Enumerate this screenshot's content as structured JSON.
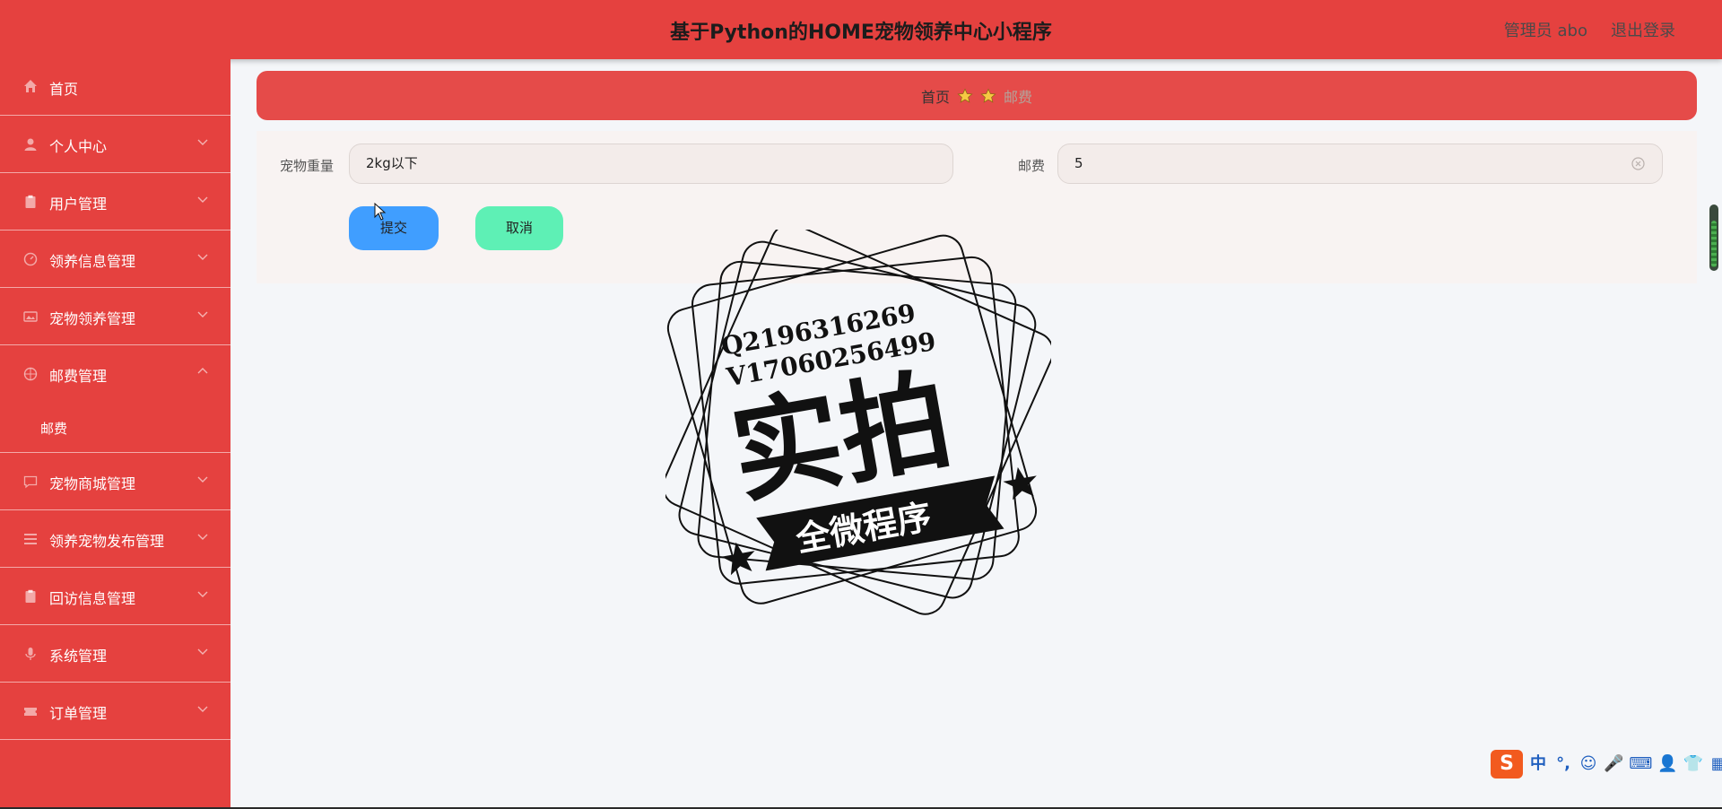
{
  "header": {
    "title": "基于Python的HOME宠物领养中心小程序",
    "user": "管理员 abo",
    "logout": "退出登录"
  },
  "sidebar": {
    "items": [
      {
        "label": "首页",
        "icon": "home-icon"
      },
      {
        "label": "个人中心",
        "icon": "user-icon"
      },
      {
        "label": "用户管理",
        "icon": "clipboard-icon"
      },
      {
        "label": "领养信息管理",
        "icon": "dashboard-icon"
      },
      {
        "label": "宠物领养管理",
        "icon": "picture-icon"
      },
      {
        "label": "邮费管理",
        "icon": "basketball-icon",
        "expanded": true,
        "sub": [
          {
            "label": "邮费"
          }
        ]
      },
      {
        "label": "宠物商城管理",
        "icon": "chat-icon"
      },
      {
        "label": "领养宠物发布管理",
        "icon": "list-icon"
      },
      {
        "label": "回访信息管理",
        "icon": "document-icon"
      },
      {
        "label": "系统管理",
        "icon": "microphone-icon"
      },
      {
        "label": "订单管理",
        "icon": "ticket-icon"
      }
    ]
  },
  "breadcrumb": {
    "home": "首页",
    "current": "邮费",
    "separator_icon": "star-icon"
  },
  "form": {
    "weight_label": "宠物重量",
    "weight_value": "2kg以下",
    "fee_label": "邮费",
    "fee_value": "5",
    "submit_label": "提交",
    "cancel_label": "取消"
  },
  "watermark": {
    "qq": "Q2196316269",
    "wechat": "V17060256499",
    "main_text": "实拍",
    "banner_text": "全微程序"
  },
  "ime": {
    "logo": "S",
    "keys": [
      "中",
      "°,",
      "☺",
      "🎤",
      "⌨",
      "👤",
      "👕",
      "▦"
    ]
  },
  "colors": {
    "accent": "#e5413f",
    "submit": "#409eff",
    "cancel": "#5ef0b5",
    "breadcrumb_current": "#b4a39a"
  }
}
